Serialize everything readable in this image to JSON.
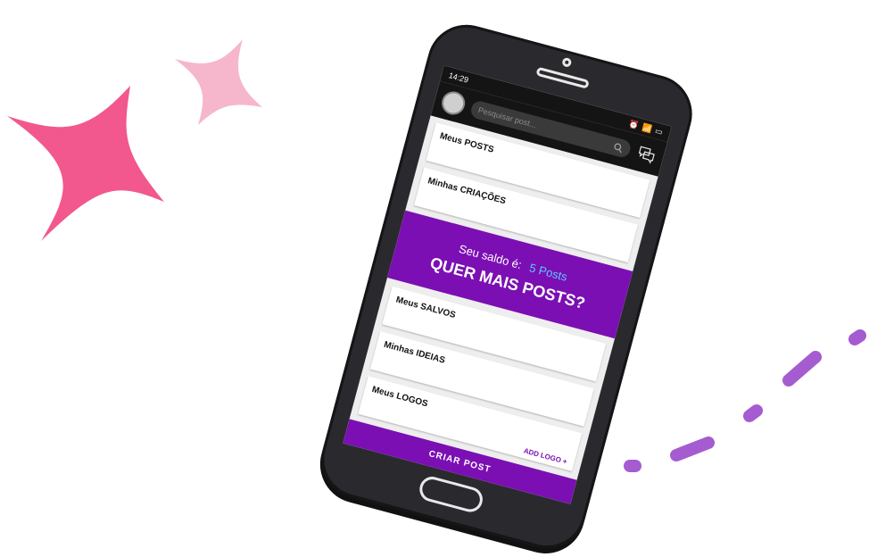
{
  "status_bar": {
    "time": "14:29"
  },
  "search": {
    "placeholder": "Pesquisar post..."
  },
  "menu": {
    "meus_posts": "Meus POSTS",
    "minhas_criacoes": "Minhas CRIAÇÕES",
    "meus_salvos": "Meus SALVOS",
    "minhas_ideias": "Minhas IDEIAS",
    "meus_logos": "Meus LOGOS"
  },
  "promo": {
    "saldo_label": "Seu saldo é:",
    "saldo_value": "5 Posts",
    "cta": "QUER MAIS POSTS?"
  },
  "add_logo": "ADD LOGO +",
  "create_button": "CRIAR POST",
  "colors": {
    "brand_purple": "#7b0fb3",
    "accent_blue": "#5ec8ff",
    "sparkle_pink": "#f2578e",
    "sparkle_light_pink": "#f6b6cc",
    "dash_purple": "#a45cd0"
  },
  "icons": [
    "avatar",
    "search-icon",
    "chat-icon",
    "alarm-icon",
    "wifi-icon",
    "battery-icon"
  ]
}
